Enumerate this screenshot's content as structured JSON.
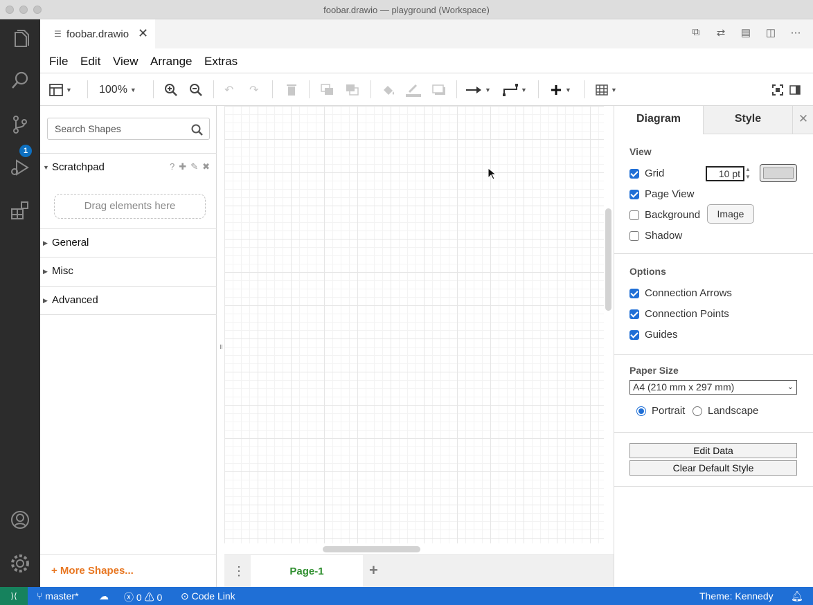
{
  "window": {
    "title": "foobar.drawio — playground (Workspace)"
  },
  "activity": {
    "scm_badge": "1"
  },
  "tab": {
    "label": "foobar.drawio",
    "close": "✕"
  },
  "menu": {
    "file": "File",
    "edit": "Edit",
    "view": "View",
    "arrange": "Arrange",
    "extras": "Extras"
  },
  "toolbar": {
    "zoom": "100%"
  },
  "shapes": {
    "search_placeholder": "Search Shapes",
    "scratchpad": "Scratchpad",
    "scratch_help": "?",
    "dropzone": "Drag elements here",
    "sections": [
      "General",
      "Misc",
      "Advanced"
    ],
    "more": "+ More Shapes..."
  },
  "canvas": {
    "page_tab": "Page-1"
  },
  "format": {
    "tab_diagram": "Diagram",
    "tab_style": "Style",
    "view_heading": "View",
    "grid": "Grid",
    "grid_size": "10 pt",
    "page_view": "Page View",
    "background": "Background",
    "image_button": "Image",
    "shadow": "Shadow",
    "options_heading": "Options",
    "connection_arrows": "Connection Arrows",
    "connection_points": "Connection Points",
    "guides": "Guides",
    "paper_heading": "Paper Size",
    "paper_size": "A4 (210 mm x 297 mm)",
    "portrait": "Portrait",
    "landscape": "Landscape",
    "edit_data": "Edit Data",
    "clear_style": "Clear Default Style",
    "checked": {
      "grid": true,
      "page_view": true,
      "background": false,
      "shadow": false,
      "connection_arrows": true,
      "connection_points": true,
      "guides": true
    },
    "orientation": "portrait"
  },
  "status": {
    "branch": "master*",
    "errors": "0",
    "warnings": "0",
    "code_link": "Code Link",
    "theme": "Theme: Kennedy"
  },
  "colors": {
    "accent": "#1f6fd6",
    "statusbar": "#1f6fd6",
    "remote": "#16825d",
    "activitybar": "#2c2c2c",
    "more_shapes": "#e87722",
    "page_tab": "#2f8f2f"
  }
}
